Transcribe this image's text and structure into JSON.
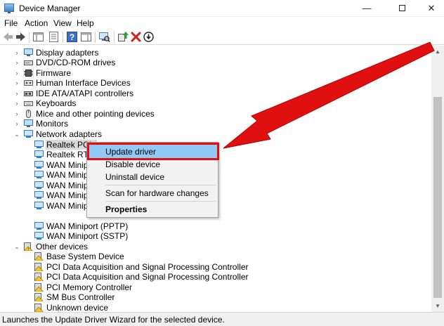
{
  "window": {
    "title": "Device Manager",
    "minimize_glyph": "—",
    "close_glyph": "✕"
  },
  "menu": {
    "items": [
      "File",
      "Action",
      "View",
      "Help"
    ]
  },
  "toolbar": {
    "buttons": [
      "back-icon",
      "forward-icon",
      "show-hide-console-tree-icon",
      "properties-icon",
      "help-icon",
      "show-action-pane-icon",
      "scan-hardware-icon",
      "update-driver-icon",
      "uninstall-icon",
      "disable-icon"
    ]
  },
  "tree": {
    "categories": [
      {
        "label": "Display adapters",
        "icon": "display-icon"
      },
      {
        "label": "DVD/CD-ROM drives",
        "icon": "dvd-drive-icon"
      },
      {
        "label": "Firmware",
        "icon": "firmware-icon"
      },
      {
        "label": "Human Interface Devices",
        "icon": "hid-icon"
      },
      {
        "label": "IDE ATA/ATAPI controllers",
        "icon": "ide-controller-icon"
      },
      {
        "label": "Keyboards",
        "icon": "keyboard-icon"
      },
      {
        "label": "Mice and other pointing devices",
        "icon": "mouse-icon"
      },
      {
        "label": "Monitors",
        "icon": "monitor-icon"
      }
    ],
    "network_adapters": {
      "label": "Network adapters",
      "children": [
        "Realtek PCIe",
        "Realtek RTL8",
        "WAN Minipor",
        "WAN Minipor",
        "WAN Minipor",
        "WAN Minipor",
        "WAN Minipor",
        "WAN Miniport (PPTP)",
        "WAN Miniport (SSTP)"
      ]
    },
    "other_devices": {
      "label": "Other devices",
      "children": [
        "Base System Device",
        "PCI Data Acquisition and Signal Processing Controller",
        "PCI Data Acquisition and Signal Processing Controller",
        "PCI Memory Controller",
        "SM Bus Controller",
        "Unknown device"
      ]
    }
  },
  "context_menu": {
    "update_driver": "Update driver",
    "disable_device": "Disable device",
    "uninstall_device": "Uninstall device",
    "scan_hardware": "Scan for hardware changes",
    "properties": "Properties"
  },
  "status": {
    "text": "Launches the Update Driver Wizard for the selected device."
  },
  "colors": {
    "highlight": "#91c9f7",
    "annotation_red": "#e01010",
    "warning_yellow": "#f3c623",
    "network_blue": "#2f7fd0"
  }
}
